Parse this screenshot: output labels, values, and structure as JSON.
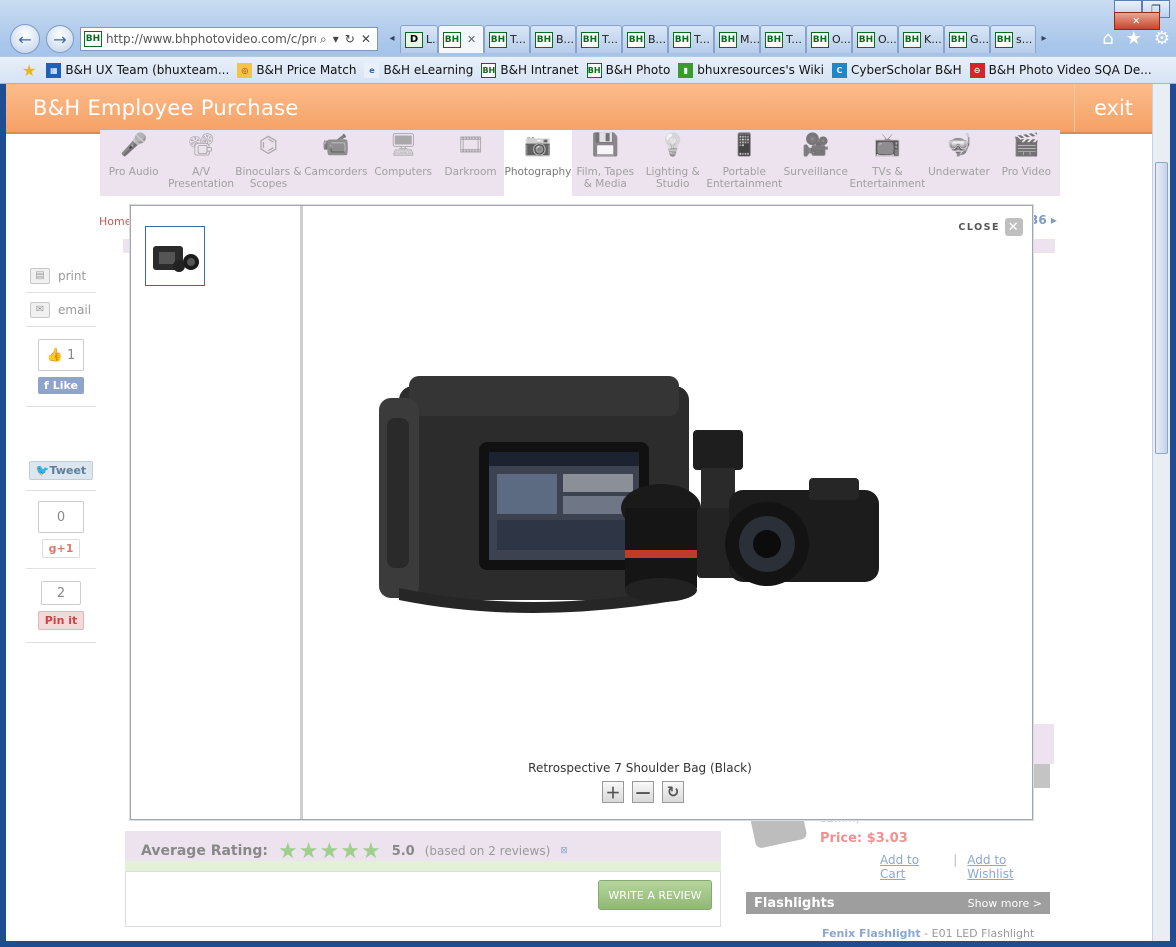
{
  "browser": {
    "url": "http://www.bhphotovideo.com/c/pro",
    "tabs": [
      {
        "icon": "D",
        "label": "L..."
      },
      {
        "icon": "BH",
        "label": "",
        "active": true
      },
      {
        "icon": "BH",
        "label": "T..."
      },
      {
        "icon": "BH",
        "label": "B..."
      },
      {
        "icon": "BH",
        "label": "T..."
      },
      {
        "icon": "BH",
        "label": "B..."
      },
      {
        "icon": "BH",
        "label": "T..."
      },
      {
        "icon": "BH",
        "label": "M..."
      },
      {
        "icon": "BH",
        "label": "T..."
      },
      {
        "icon": "BH",
        "label": "O..."
      },
      {
        "icon": "BH",
        "label": "O..."
      },
      {
        "icon": "BH",
        "label": "K..."
      },
      {
        "icon": "BH",
        "label": "G..."
      },
      {
        "icon": "BH",
        "label": "s..."
      }
    ],
    "favorites": [
      {
        "label": "B&H UX Team (bhuxteam..."
      },
      {
        "label": "B&H Price Match"
      },
      {
        "label": "B&H eLearning"
      },
      {
        "label": "B&H Intranet"
      },
      {
        "label": "B&H Photo"
      },
      {
        "label": "bhuxresources's Wiki"
      },
      {
        "label": "CyberScholar B&H"
      },
      {
        "label": "B&H Photo Video SQA De..."
      }
    ]
  },
  "header": {
    "title": "B&H Employee Purchase",
    "exit_label": "exit"
  },
  "categories": [
    {
      "label": "Pro Audio",
      "icon": "mic-icon"
    },
    {
      "label": "A/V Presentation",
      "icon": "projector-icon"
    },
    {
      "label": "Binoculars & Scopes",
      "icon": "binoculars-icon"
    },
    {
      "label": "Camcorders",
      "icon": "camcorder-icon"
    },
    {
      "label": "Computers",
      "icon": "computer-icon"
    },
    {
      "label": "Darkroom",
      "icon": "film-strip-icon"
    },
    {
      "label": "Photography",
      "icon": "camera-icon",
      "active": true
    },
    {
      "label": "Film, Tapes & Media",
      "icon": "media-icon"
    },
    {
      "label": "Lighting & Studio",
      "icon": "tripod-light-icon"
    },
    {
      "label": "Portable Entertainment",
      "icon": "mp3-player-icon"
    },
    {
      "label": "Surveillance",
      "icon": "security-camera-icon"
    },
    {
      "label": "TVs & Entertainment",
      "icon": "tv-icon"
    },
    {
      "label": "Underwater",
      "icon": "underwater-camera-icon"
    },
    {
      "label": "Pro Video",
      "icon": "pro-video-camera-icon"
    }
  ],
  "breadcrumb": {
    "home": "Home"
  },
  "pager": {
    "text": "36 ▸"
  },
  "share": {
    "print_label": "print",
    "email_label": "email",
    "like_count": "1",
    "like_label": "Like",
    "tweet_label": "Tweet",
    "gplus_count": "0",
    "gplus_label": "+1",
    "pin_count": "2",
    "pin_label": "Pin it"
  },
  "modal": {
    "close_label": "CLOSE",
    "caption": "Retrospective 7 Shoulder Bag (Black)"
  },
  "reviews": {
    "label": "Average Rating:",
    "stars": 5,
    "value": "5.0",
    "note": "(based on 2 reviews)",
    "write_label": "WRITE A REVIEW"
  },
  "sidebar": {
    "item_sub": "82mm)",
    "item_price": "Price: $3.03",
    "add_to_cart": "Add to Cart",
    "add_to_wishlist": "Add to Wishlist",
    "flashlights_title": "Flashlights",
    "show_more": "Show more >",
    "flash_item_name": "Fenix Flashlight",
    "flash_item_desc": " - E01 LED Flashlight"
  },
  "colors": {
    "header_orange": "#f6a066",
    "category_bg": "#ede3ee",
    "accent_blue": "#3c6aa8",
    "review_green": "#8fb874"
  }
}
